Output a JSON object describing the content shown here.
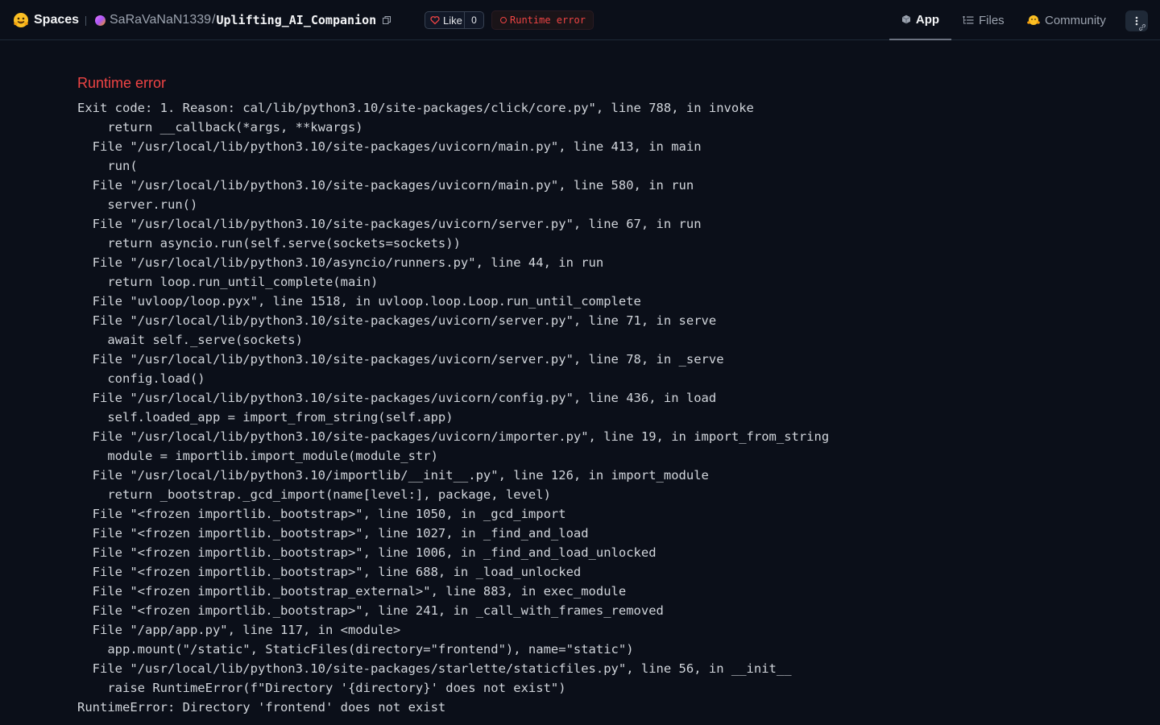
{
  "header": {
    "brand_label": "Spaces",
    "owner": "SaRaVaNaN1339",
    "separator": "/",
    "repo_name": "Uplifting_AI_Companion",
    "like_label": "Like",
    "like_count": "0",
    "status_label": "Runtime error",
    "status_color": "#ef4444"
  },
  "tabs": [
    {
      "label": "App",
      "icon": "cube-icon",
      "active": true
    },
    {
      "label": "Files",
      "icon": "file-tree-icon",
      "active": false
    },
    {
      "label": "Community",
      "icon": "community-icon",
      "active": false
    }
  ],
  "main": {
    "error_title": "Runtime error",
    "log_lines": [
      "Exit code: 1. Reason: cal/lib/python3.10/site-packages/click/core.py\", line 788, in invoke",
      "    return __callback(*args, **kwargs)",
      "  File \"/usr/local/lib/python3.10/site-packages/uvicorn/main.py\", line 413, in main",
      "    run(",
      "  File \"/usr/local/lib/python3.10/site-packages/uvicorn/main.py\", line 580, in run",
      "    server.run()",
      "  File \"/usr/local/lib/python3.10/site-packages/uvicorn/server.py\", line 67, in run",
      "    return asyncio.run(self.serve(sockets=sockets))",
      "  File \"/usr/local/lib/python3.10/asyncio/runners.py\", line 44, in run",
      "    return loop.run_until_complete(main)",
      "  File \"uvloop/loop.pyx\", line 1518, in uvloop.loop.Loop.run_until_complete",
      "  File \"/usr/local/lib/python3.10/site-packages/uvicorn/server.py\", line 71, in serve",
      "    await self._serve(sockets)",
      "  File \"/usr/local/lib/python3.10/site-packages/uvicorn/server.py\", line 78, in _serve",
      "    config.load()",
      "  File \"/usr/local/lib/python3.10/site-packages/uvicorn/config.py\", line 436, in load",
      "    self.loaded_app = import_from_string(self.app)",
      "  File \"/usr/local/lib/python3.10/site-packages/uvicorn/importer.py\", line 19, in import_from_string",
      "    module = importlib.import_module(module_str)",
      "  File \"/usr/local/lib/python3.10/importlib/__init__.py\", line 126, in import_module",
      "    return _bootstrap._gcd_import(name[level:], package, level)",
      "  File \"<frozen importlib._bootstrap>\", line 1050, in _gcd_import",
      "  File \"<frozen importlib._bootstrap>\", line 1027, in _find_and_load",
      "  File \"<frozen importlib._bootstrap>\", line 1006, in _find_and_load_unlocked",
      "  File \"<frozen importlib._bootstrap>\", line 688, in _load_unlocked",
      "  File \"<frozen importlib._bootstrap_external>\", line 883, in exec_module",
      "  File \"<frozen importlib._bootstrap>\", line 241, in _call_with_frames_removed",
      "  File \"/app/app.py\", line 117, in <module>",
      "    app.mount(\"/static\", StaticFiles(directory=\"frontend\"), name=\"static\")",
      "  File \"/usr/local/lib/python3.10/site-packages/starlette/staticfiles.py\", line 56, in __init__",
      "    raise RuntimeError(f\"Directory '{directory}' does not exist\")",
      "RuntimeError: Directory 'frontend' does not exist"
    ]
  }
}
